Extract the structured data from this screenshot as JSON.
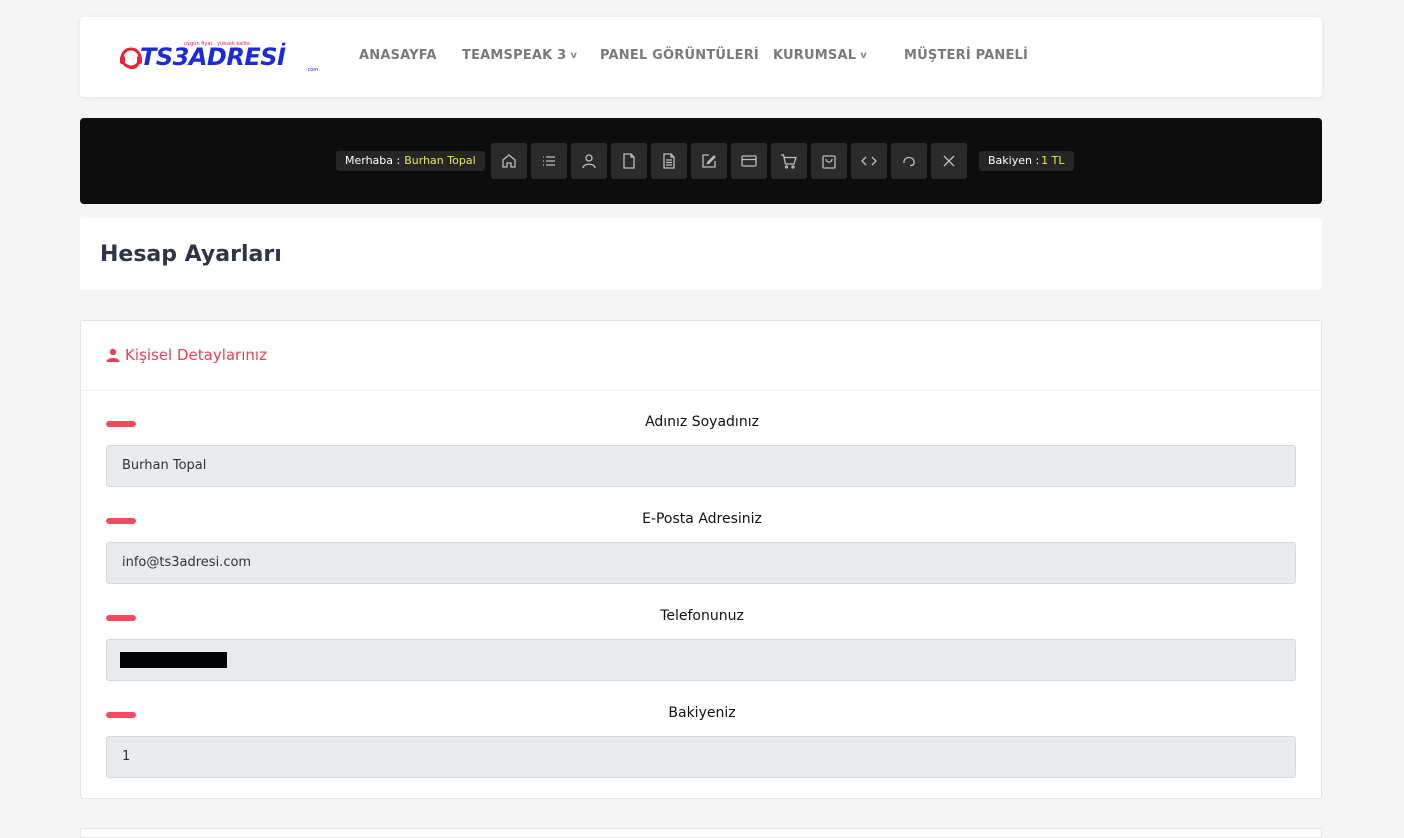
{
  "logo": {
    "tagline": "uygun fiyat . yüksek kalite",
    "brand": "TS3ADRESİ",
    "suffix": ".com"
  },
  "nav": [
    {
      "label": "ANASAYFA",
      "dropdown": false
    },
    {
      "label": "TEAMSPEAK 3",
      "dropdown": true
    },
    {
      "label": "PANEL GÖRÜNTÜLERİ",
      "dropdown": false
    },
    {
      "label": "KURUMSAL",
      "dropdown": true
    },
    {
      "label": "MÜŞTERİ PANELİ",
      "dropdown": false
    }
  ],
  "toolbar": {
    "greeting": "Merhaba :",
    "user": "Burhan Topal",
    "balance_label": "Bakiyen :",
    "balance_value": "1 TL",
    "buttons": [
      "home-icon",
      "list-icon",
      "user-icon",
      "file-icon",
      "document-icon",
      "edit-icon",
      "credit-card-icon",
      "cart-icon",
      "shopping-bag-icon",
      "code-icon",
      "support-icon",
      "close-icon"
    ]
  },
  "page": {
    "title": "Hesap Ayarları"
  },
  "form": {
    "title": "Kişisel Detaylarınız",
    "fields": [
      {
        "label": "Adınız Soyadınız",
        "value": "Burhan Topal"
      },
      {
        "label": "E-Posta Adresiniz",
        "value": "info@ts3adresi.com"
      },
      {
        "label": "Telefonunuz",
        "value": ""
      },
      {
        "label": "Bakiyeniz",
        "value": "1"
      }
    ]
  },
  "colors": {
    "accent": "#e84057",
    "field_bar": "#f24b60",
    "toolbar_bg": "#0d0d0d",
    "highlight": "#e8e84a",
    "title": "#2e3549"
  }
}
